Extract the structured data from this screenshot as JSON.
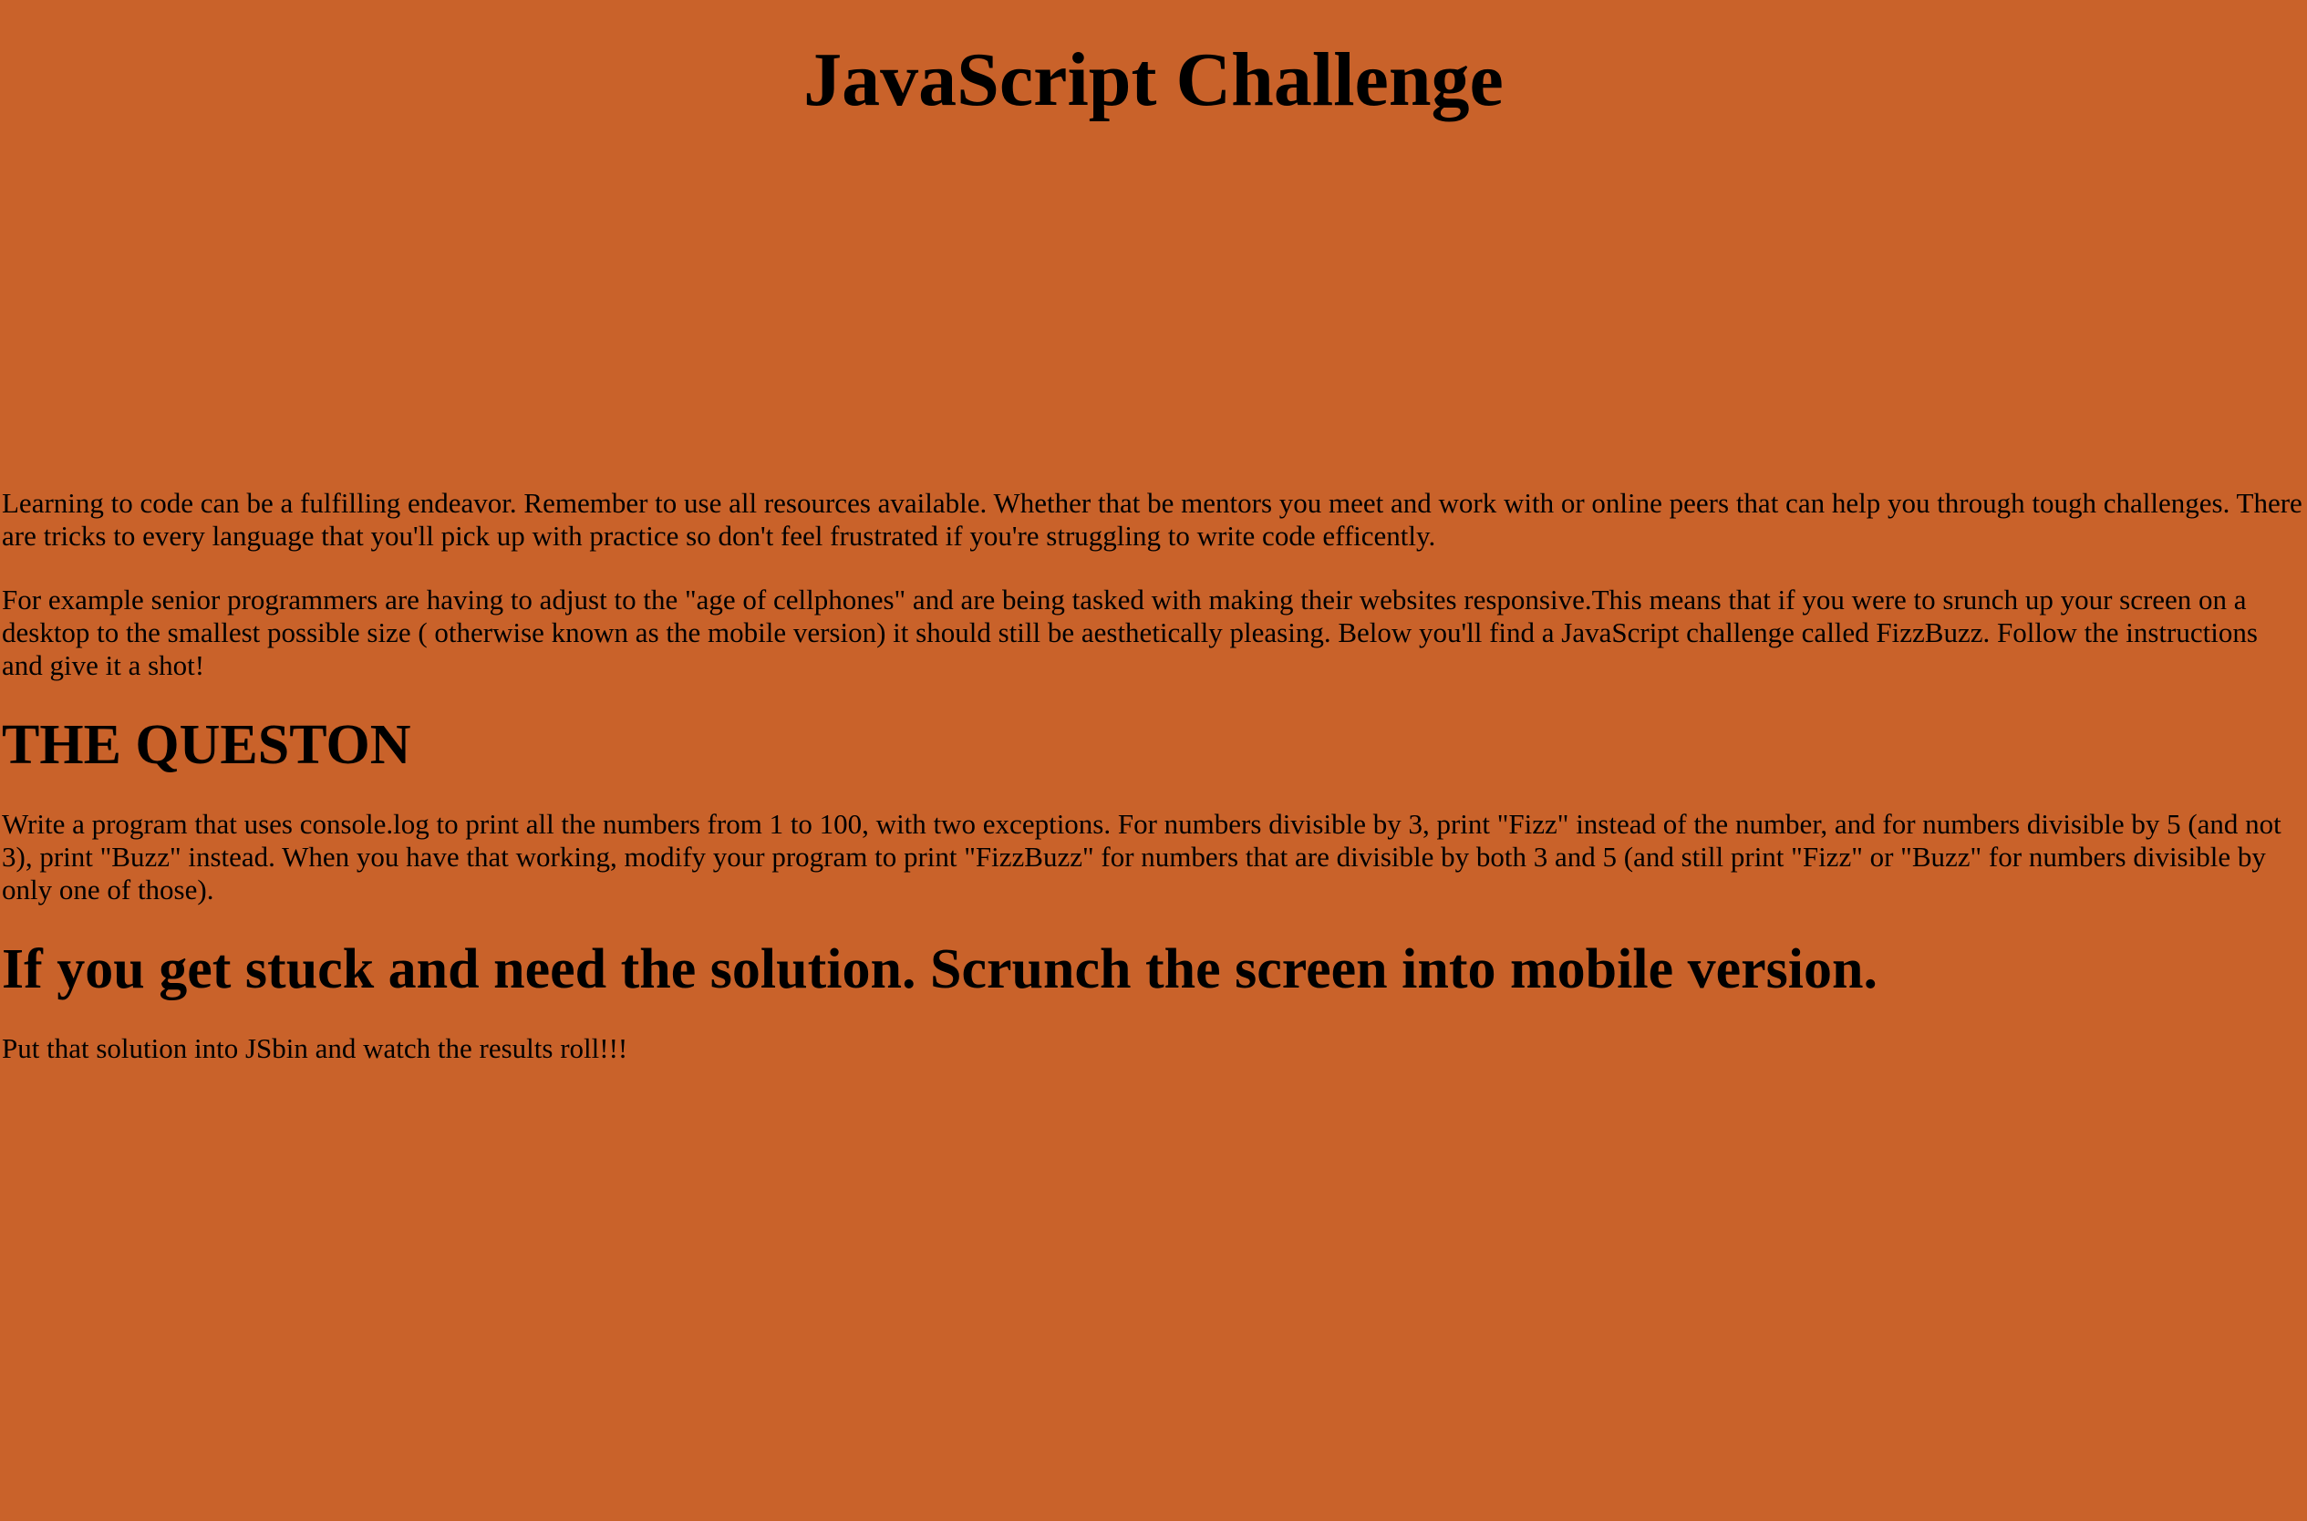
{
  "header": {
    "title": "JavaScript Challenge"
  },
  "intro": {
    "paragraph1": "Learning to code can be a fulfilling endeavor. Remember to use all resources available. Whether that be mentors you meet and work with or online peers that can help you through tough challenges. There are tricks to every language that you'll pick up with practice so don't feel frustrated if you're struggling to write code efficently.",
    "paragraph2": "For example senior programmers are having to adjust to the \"age of cellphones\" and are being tasked with making their websites responsive.This means that if you were to srunch up your screen on a desktop to the smallest possible size ( otherwise known as the mobile version) it should still be aesthetically pleasing. Below you'll find a JavaScript challenge called FizzBuzz. Follow the instructions and give it a shot!"
  },
  "question": {
    "heading": "THE QUESTON",
    "body": "Write a program that uses console.log to print all the numbers from 1 to 100, with two exceptions. For numbers divisible by 3, print \"Fizz\" instead of the number, and for numbers divisible by 5 (and not 3), print \"Buzz\" instead. When you have that working, modify your program to print \"FizzBuzz\" for numbers that are divisible by both 3 and 5 (and still print \"Fizz\" or \"Buzz\" for numbers divisible by only one of those)."
  },
  "hint": {
    "heading": "If you get stuck and need the solution. Scrunch the screen into mobile version.",
    "body": "Put that solution into JSbin and watch the results roll!!!"
  },
  "colors": {
    "background": "#c9622a",
    "text": "#000000"
  }
}
